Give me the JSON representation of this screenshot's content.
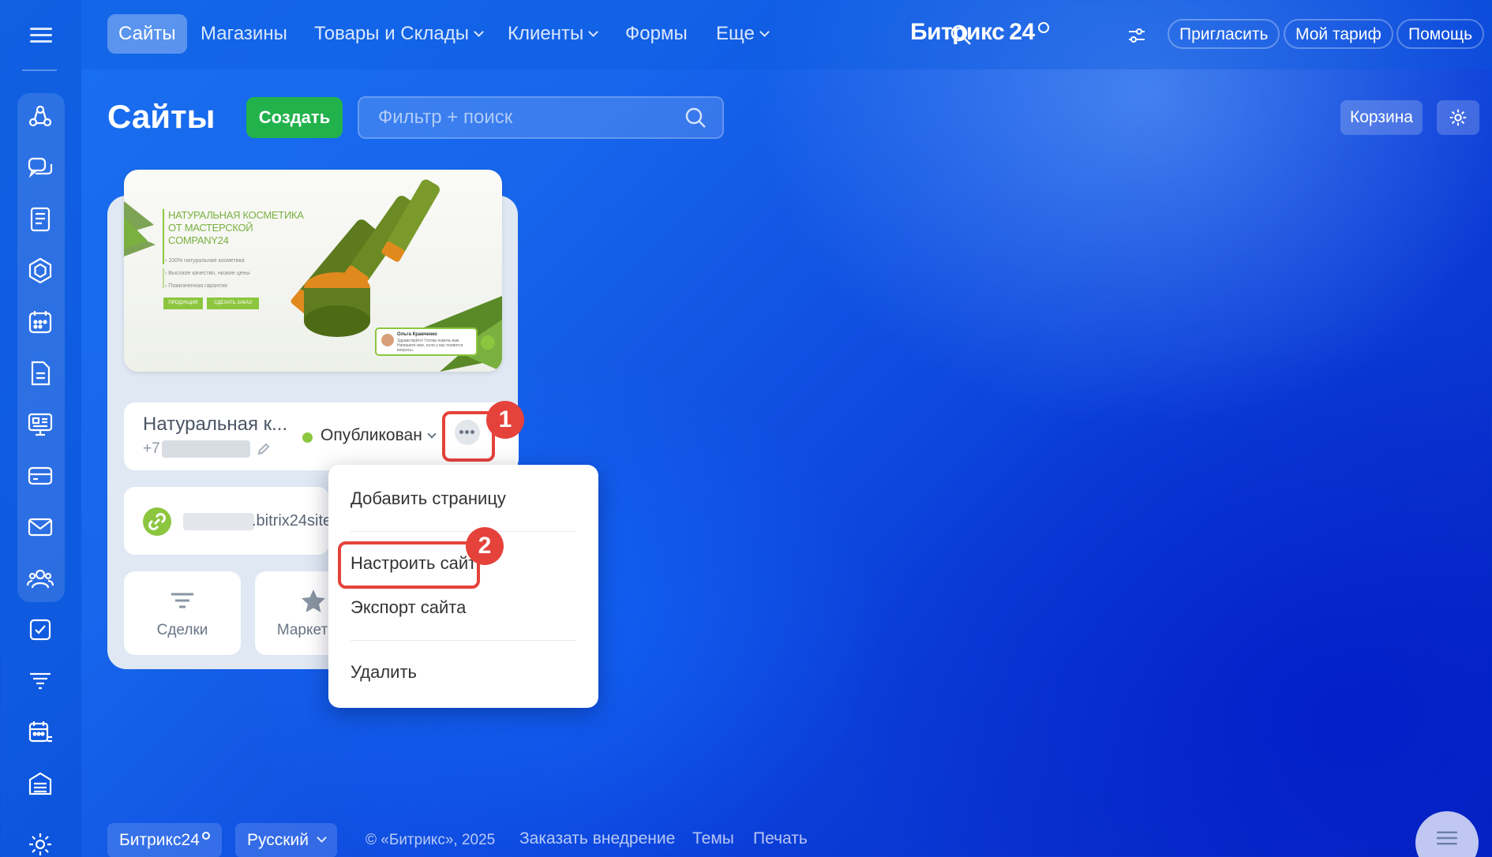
{
  "topnav": {
    "items": [
      {
        "label": "Сайты",
        "active": true
      },
      {
        "label": "Магазины"
      },
      {
        "label": "Товары и Склады"
      },
      {
        "label": "Клиенты"
      },
      {
        "label": "Формы"
      },
      {
        "label": "Еще"
      }
    ],
    "brand": "Битрикс",
    "brand_num": "24",
    "invite": "Пригласить",
    "tariff": "Мой тариф",
    "help": "Помощь"
  },
  "toolbar": {
    "title": "Сайты",
    "create_label": "Создать",
    "search_placeholder": "Фильтр + поиск",
    "trash_label": "Корзина"
  },
  "site_card": {
    "preview": {
      "headline": [
        "НАТУРАЛЬНАЯ КОСМЕТИКА",
        "ОТ МАСТЕРСКОЙ",
        "COMPANY24"
      ],
      "bullets": [
        "100% натуральная косметика",
        "Высокое качество, низкие цены",
        "Пожизненная гарантия"
      ],
      "btn1": "ПРОДУКЦИЯ",
      "btn2": "СДЕЛАТЬ ЗАКАЗ",
      "chat_name": "Ольга Кравченко",
      "chat_msg": "Здравствуйте! Готова помочь вам. Напишите мне, если у вас появятся вопросы."
    },
    "name": "Натуральная к...",
    "phone_prefix": "+7",
    "status": "Опубликован",
    "url_suffix": ".bitrix24site",
    "tiles": [
      {
        "label": "Сделки"
      },
      {
        "label": "Маркетинг"
      }
    ]
  },
  "dropdown": {
    "items": [
      "Добавить страницу",
      "Настроить сайт",
      "Экспорт сайта",
      "Удалить"
    ]
  },
  "annotations": {
    "one": "1",
    "two": "2"
  },
  "footer": {
    "brand": "Битрикс24",
    "language": "Русский",
    "copyright": "© «Битрикс», 2025",
    "links": [
      "Заказать внедрение",
      "Темы",
      "Печать"
    ]
  },
  "colors": {
    "accent_green": "#22b24c",
    "status_green": "#8cc63f",
    "highlight_red": "#e5423b"
  }
}
